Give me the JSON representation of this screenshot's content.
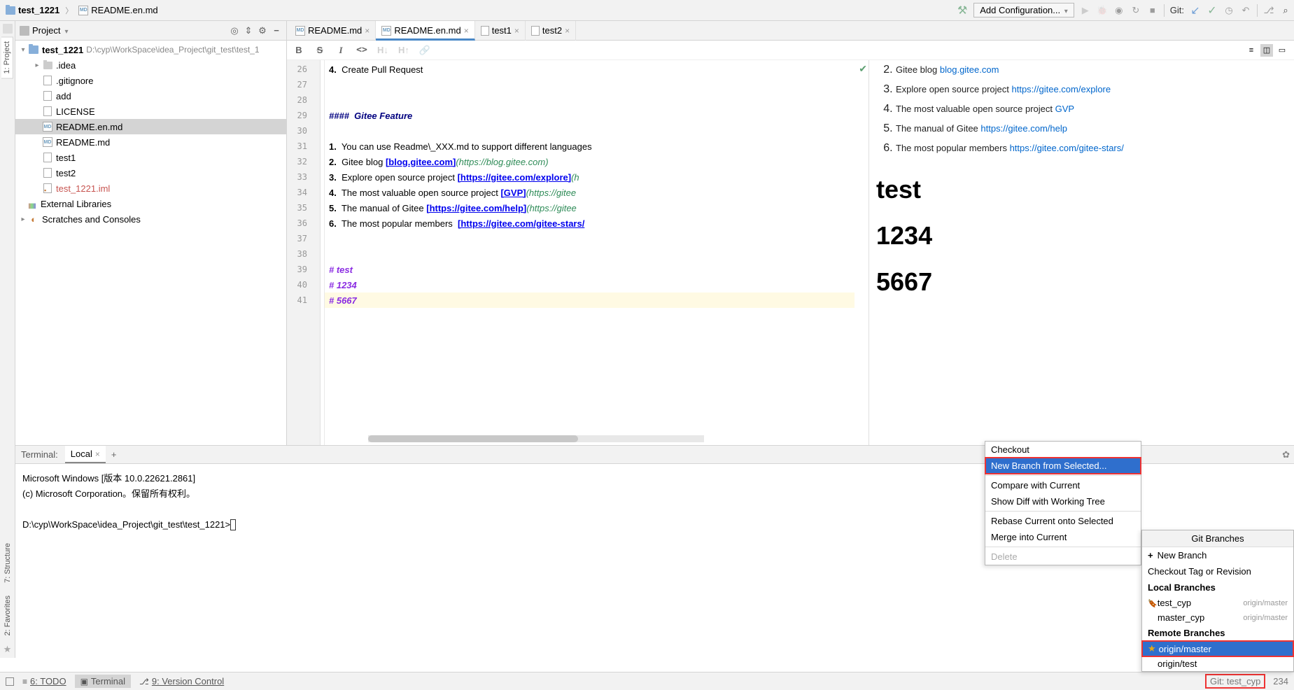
{
  "breadcrumb": {
    "project": "test_1221",
    "file": "README.en.md"
  },
  "toolbar": {
    "add_config": "Add Configuration...",
    "git_label": "Git:"
  },
  "project_panel": {
    "title": "Project",
    "root": "test_1221",
    "root_path": "D:\\cyp\\WorkSpace\\idea_Project\\git_test\\test_1",
    "items": [
      {
        "label": ".idea",
        "type": "folder",
        "indent": 2,
        "expandable": true
      },
      {
        "label": ".gitignore",
        "type": "file",
        "indent": 2
      },
      {
        "label": "add",
        "type": "file",
        "indent": 2
      },
      {
        "label": "LICENSE",
        "type": "file",
        "indent": 2
      },
      {
        "label": "README.en.md",
        "type": "md",
        "indent": 2,
        "selected": true
      },
      {
        "label": "README.md",
        "type": "md",
        "indent": 2
      },
      {
        "label": "test1",
        "type": "file",
        "indent": 2
      },
      {
        "label": "test2",
        "type": "file",
        "indent": 2
      },
      {
        "label": "test_1221.iml",
        "type": "iml",
        "indent": 2
      }
    ],
    "external": "External Libraries",
    "scratches": "Scratches and Consoles"
  },
  "tabs": [
    {
      "label": "README.md",
      "icon": "md"
    },
    {
      "label": "README.en.md",
      "icon": "md",
      "active": true
    },
    {
      "label": "test1",
      "icon": "file"
    },
    {
      "label": "test2",
      "icon": "file"
    }
  ],
  "gutter": {
    "start": 26,
    "end": 41
  },
  "code": {
    "l26": {
      "n": "4.",
      "t": "  Create Pull Request"
    },
    "l29": "####  Gitee Feature",
    "l31": {
      "n": "1.",
      "t": "  You can use Readme\\_XXX.md to support different languages"
    },
    "l32": {
      "n": "2.",
      "t": "  Gitee blog ",
      "lnk": "[blog.gitee.com]",
      "url": "(https://blog.gitee.com)"
    },
    "l33": {
      "n": "3.",
      "t": "  Explore open source project ",
      "lnk": "[https://gitee.com/explore]",
      "url": "(h"
    },
    "l34": {
      "n": "4.",
      "t": "  The most valuable open source project ",
      "lnk": "[GVP]",
      "url": "(https://gitee"
    },
    "l35": {
      "n": "5.",
      "t": "  The manual of Gitee ",
      "lnk": "[https://gitee.com/help]",
      "url": "(https://gitee"
    },
    "l36": {
      "n": "6.",
      "t": "  The most popular members  ",
      "lnk": "[https://gitee.com/gitee-stars/"
    },
    "l39": "# test",
    "l40": "# 1234",
    "l41": "# 5667"
  },
  "preview": {
    "li2": {
      "t": "Gitee blog ",
      "a": "blog.gitee.com"
    },
    "li3": {
      "t": "Explore open source project ",
      "a": "https://gitee.com/explore"
    },
    "li4": {
      "t": "The most valuable open source project ",
      "a": "GVP"
    },
    "li5": {
      "t": "The manual of Gitee ",
      "a": "https://gitee.com/help"
    },
    "li6": {
      "t": "The most popular members ",
      "a": "https://gitee.com/gitee-stars/"
    },
    "h1a": "test",
    "h1b": "1234",
    "h1c": "5667"
  },
  "terminal": {
    "label": "Terminal:",
    "tab": "Local",
    "lines": {
      "l1": "Microsoft Windows [版本 10.0.22621.2861]",
      "l2": "(c) Microsoft Corporation。保留所有权利。",
      "l3": "D:\\cyp\\WorkSpace\\idea_Project\\git_test\\test_1221>"
    }
  },
  "left_tabs": {
    "project": "1: Project",
    "structure": "7: Structure",
    "favorites": "2: Favorites"
  },
  "status": {
    "todo": "6: TODO",
    "terminal": "Terminal",
    "vc": "9: Version Control",
    "git": "Git: test_cyp",
    "enc": "234"
  },
  "branches": {
    "title": "Git Branches",
    "new_branch": "New Branch",
    "checkout_tag": "Checkout Tag or Revision",
    "local_heading": "Local Branches",
    "local": [
      {
        "name": "test_cyp",
        "track": "origin/master"
      },
      {
        "name": "master_cyp",
        "track": "origin/master"
      }
    ],
    "remote_heading": "Remote Branches",
    "remote": [
      {
        "name": "origin/master",
        "selected": true,
        "star": true
      },
      {
        "name": "origin/test"
      }
    ]
  },
  "context": {
    "checkout": "Checkout",
    "new_branch": "New Branch from Selected...",
    "compare": "Compare with Current",
    "diff": "Show Diff with Working Tree",
    "rebase": "Rebase Current onto Selected",
    "merge": "Merge into Current",
    "delete": "Delete"
  }
}
